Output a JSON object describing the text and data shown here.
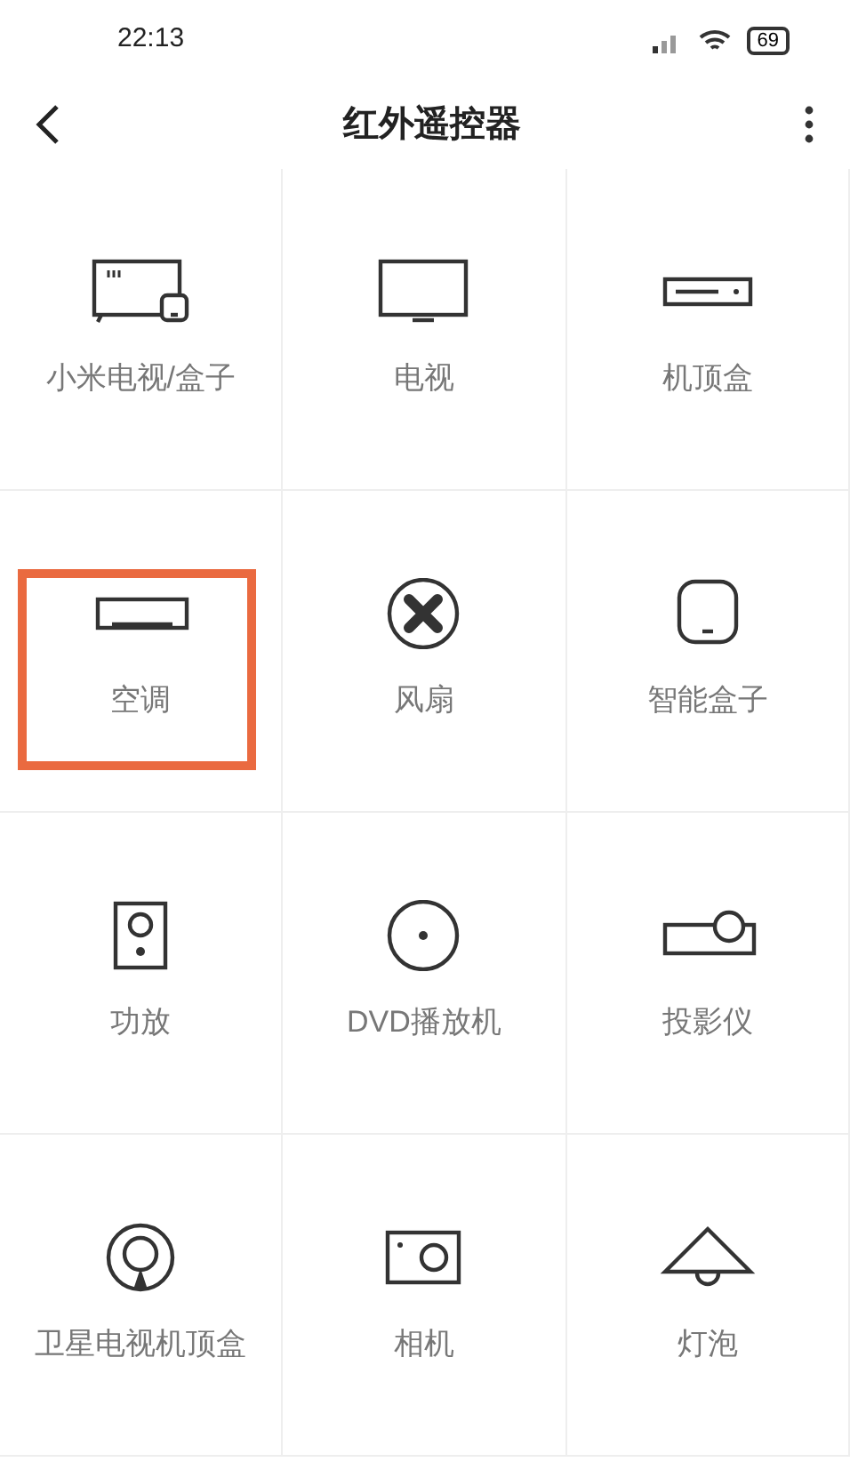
{
  "status_bar": {
    "time": "22:13",
    "battery": "69"
  },
  "header": {
    "title": "红外遥控器"
  },
  "devices": [
    {
      "label": "小米电视/盒子",
      "kind": "mitv",
      "highlighted": false
    },
    {
      "label": "电视",
      "kind": "tv",
      "highlighted": false
    },
    {
      "label": "机顶盒",
      "kind": "settop",
      "highlighted": false
    },
    {
      "label": "空调",
      "kind": "ac",
      "highlighted": true
    },
    {
      "label": "风扇",
      "kind": "fan",
      "highlighted": false
    },
    {
      "label": "智能盒子",
      "kind": "box",
      "highlighted": false
    },
    {
      "label": "功放",
      "kind": "speaker",
      "highlighted": false
    },
    {
      "label": "DVD播放机",
      "kind": "dvd",
      "highlighted": false
    },
    {
      "label": "投影仪",
      "kind": "projector",
      "highlighted": false
    },
    {
      "label": "卫星电视机顶盒",
      "kind": "satellite",
      "highlighted": false
    },
    {
      "label": "相机",
      "kind": "camera",
      "highlighted": false
    },
    {
      "label": "灯泡",
      "kind": "lamp",
      "highlighted": false
    }
  ]
}
